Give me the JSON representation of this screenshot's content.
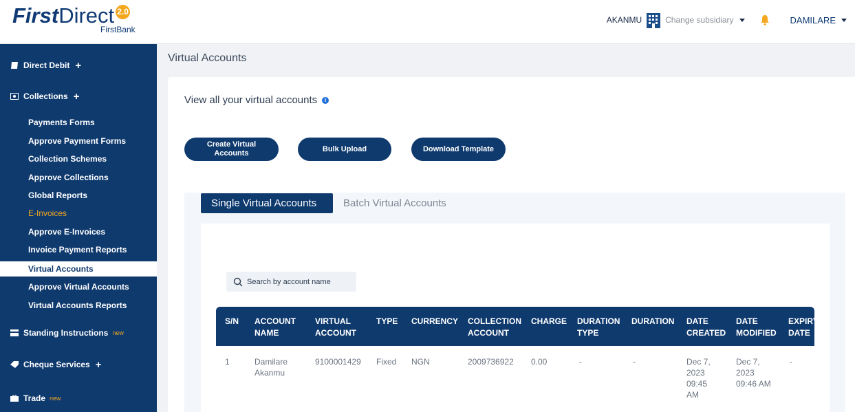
{
  "brand": {
    "logo_bold": "First",
    "logo_light": "Direct",
    "version": "2.0",
    "sub": "FirstBank"
  },
  "header": {
    "user_short": "AKANMU",
    "subsidiary_label": "Change subsidiary",
    "user_name": "DAMILARE"
  },
  "sidebar": {
    "groups": [
      {
        "label": "Direct Debit",
        "suffix": "+",
        "icon": "book-icon"
      },
      {
        "label": "Collections",
        "suffix": "+",
        "icon": "cash-icon"
      },
      {
        "label": "Standing Instructions",
        "suffix": "new",
        "icon": "card-icon"
      },
      {
        "label": "Cheque Services",
        "suffix": "+",
        "icon": "tag-icon"
      },
      {
        "label": "Trade",
        "suffix": "new",
        "icon": "briefcase-icon"
      }
    ],
    "items": [
      "Payments Forms",
      "Approve Payment Forms",
      "Collection Schemes",
      "Approve Collections",
      "Global Reports",
      "E-Invoices",
      "Approve E-Invoices",
      "Invoice Payment Reports",
      "Virtual Accounts",
      "Approve Virtual Accounts",
      "Virtual Accounts Reports"
    ]
  },
  "main": {
    "title": "Virtual Accounts",
    "subtitle": "View all your virtual accounts",
    "buttons": {
      "create_line1": "Create Virtual",
      "create_line2": "Accounts",
      "bulk": "Bulk Upload",
      "download": "Download Template"
    },
    "tabs": [
      "Single Virtual Accounts",
      "Batch Virtual Accounts"
    ],
    "search_placeholder": "Search by account name"
  },
  "table": {
    "headers": [
      [
        "S/N",
        ""
      ],
      [
        "ACCOUNT",
        "NAME"
      ],
      [
        "VIRTUAL",
        "ACCOUNT"
      ],
      [
        "TYPE",
        ""
      ],
      [
        "CURRENCY",
        ""
      ],
      [
        "COLLECTION",
        "ACCOUNT"
      ],
      [
        "CHARGE",
        ""
      ],
      [
        "DURATION",
        "TYPE"
      ],
      [
        "DURATION",
        ""
      ],
      [
        "DATE",
        "CREATED"
      ],
      [
        "DATE",
        "MODIFIED"
      ],
      [
        "EXPIRY",
        "DATE"
      ]
    ],
    "rows": [
      {
        "sn": "1",
        "account_name": [
          "Damilare",
          "Akanmu"
        ],
        "virtual_account": "9100001429",
        "type": "Fixed",
        "currency": "NGN",
        "collection_account": "2009736922",
        "charge": "0.00",
        "duration_type": "-",
        "duration": "-",
        "date_created": [
          "Dec 7,",
          "2023",
          "09:45",
          "AM"
        ],
        "date_modified": [
          "Dec 7,",
          "2023",
          "09:46 AM"
        ],
        "expiry_date": "-"
      }
    ]
  }
}
